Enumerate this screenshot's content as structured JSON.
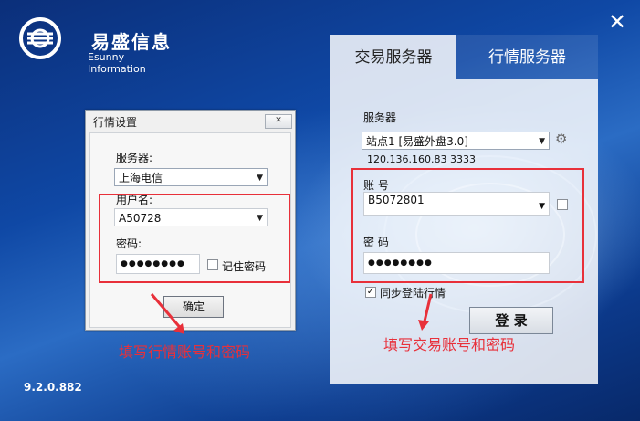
{
  "app": {
    "logo_cn": "易盛信息",
    "logo_en": "Esunny Information",
    "version": "9.2.0.882",
    "close_icon": "close-icon"
  },
  "login_panel": {
    "tabs": [
      {
        "label": "交易服务器",
        "active": true
      },
      {
        "label": "行情服务器",
        "active": false
      }
    ],
    "server_label": "服务器",
    "server_value": "站点1  [易盛外盘3.0]",
    "server_address": "120.136.160.83  3333",
    "account_label": "账 号",
    "account_value": "B5072801",
    "password_label": "密 码",
    "password_value": "●●●●●●●●",
    "sync_quote_label": "同步登陆行情",
    "sync_quote_checked": true,
    "login_button": "登 录"
  },
  "quote_dialog": {
    "title": "行情设置",
    "close_label": "✕",
    "server_label": "服务器:",
    "server_value": "上海电信",
    "username_label": "用户名:",
    "username_value": "A50728",
    "password_label": "密码:",
    "password_value": "●●●●●●●●",
    "remember_label": "记住密码",
    "ok_button": "确定"
  },
  "annotations": {
    "left": "填写行情账号和密码",
    "right": "填写交易账号和密码",
    "color": "#e8303a"
  }
}
